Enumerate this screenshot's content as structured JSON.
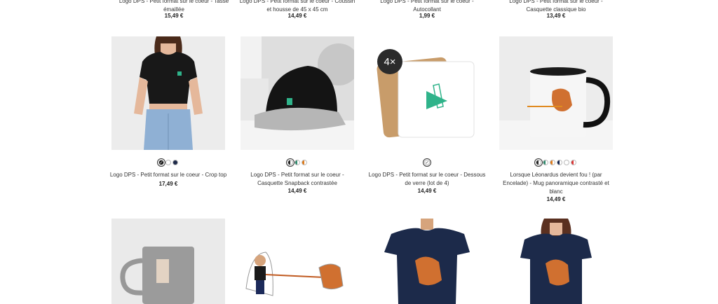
{
  "top_row": [
    {
      "title_line1": "Logo DPS - Petit format sur le coeur - Tasse",
      "title_line2": "émaillée",
      "price": "15,49 €"
    },
    {
      "title_line1": "Logo DPS - Petit format sur le coeur - Coussin",
      "title_line2": "et housse de 45 x 45 cm",
      "price": "14,49 €"
    },
    {
      "title_line1": "Logo DPS - Petit format sur le coeur -",
      "title_line2": "Autocollant",
      "price": "1,99 €"
    },
    {
      "title_line1": "Logo DPS - Petit format sur le coeur -",
      "title_line2": "Casquette classique bio",
      "price": "13,49 €"
    }
  ],
  "products": [
    {
      "title_line1": "Logo DPS - Petit format sur le coeur - Crop top",
      "title_line2": "",
      "title_line3": "",
      "price": "17,49 €",
      "swatches": [
        "#111111",
        "#ffffff",
        "#1d2a4a"
      ]
    },
    {
      "title_line1": "Logo DPS - Petit format sur le coeur -",
      "title_line2": "Casquette Snapback contrastée",
      "title_line3": "",
      "price": "14,49 €",
      "swatches": [
        "split",
        "split2",
        "split3"
      ]
    },
    {
      "title_line1": "Logo DPS - Petit format sur le coeur - Dessous",
      "title_line2": "de verre (lot de 4)",
      "title_line3": "",
      "price": "14,49 €",
      "badge": "4×",
      "swatches": [
        "#ffffff"
      ]
    },
    {
      "title_line1": "Lorsque Léonardus devient fou ! (par",
      "title_line2": "Encelade) - Mug panoramique contrasté et",
      "title_line3": "blanc",
      "price": "14,49 €",
      "swatches": [
        "split",
        "split2",
        "split3",
        "split4",
        "#ffffff",
        "split5"
      ]
    }
  ]
}
